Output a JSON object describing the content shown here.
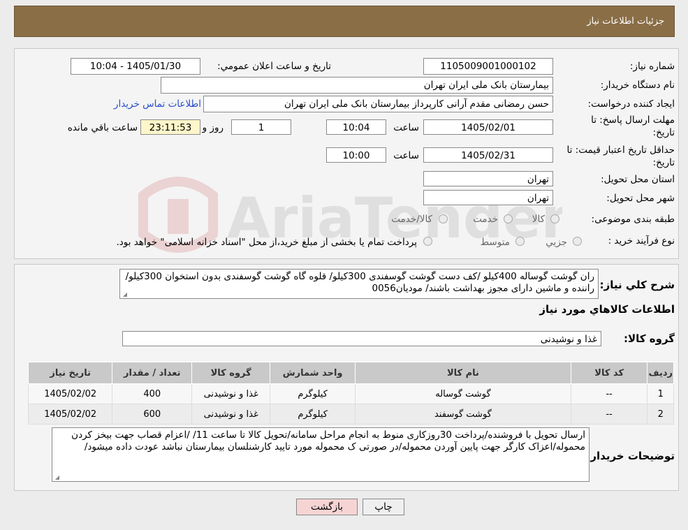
{
  "header": {
    "title": "جزئیات اطلاعات نیاز"
  },
  "need_number": {
    "label": "شماره نیاز:",
    "value": "1105009001000102"
  },
  "announce_datetime": {
    "label": "تاریخ و ساعت اعلان عمومي:",
    "value": "1405/01/30 - 10:04"
  },
  "buyer_org": {
    "label": "نام دستگاه خريدار:",
    "value": "بيمارستان بانک ملی ايران تهران"
  },
  "requester": {
    "label": "ايجاد کننده درخواست:",
    "value": "حسن رمضانی مقدم آرانی کارپرداز بيمارستان بانک ملی ايران تهران",
    "contact_link": "اطلاعات تماس خريدار"
  },
  "reply_deadline": {
    "label_line1": "مهلت ارسال پاسخ: تا",
    "label_line2": "تاريخ:",
    "date": "1405/02/01",
    "time_label": "ساعت",
    "time": "10:04",
    "days": "1",
    "days_label": "روز و",
    "remaining": "23:11:53",
    "remaining_label": "ساعت باقي مانده"
  },
  "price_validity": {
    "label_line1": "حداقل تاريخ اعتبار قيمت: تا",
    "label_line2": "تاريخ:",
    "date": "1405/02/31",
    "time_label": "ساعت",
    "time": "10:00"
  },
  "delivery_province": {
    "label": "استان محل تحويل:",
    "value": "تهران"
  },
  "delivery_city": {
    "label": "شهر محل تحويل:",
    "value": "تهران"
  },
  "category": {
    "label": "طبقه بندی موضوعی:",
    "options": [
      "کالا",
      "خدمت",
      "کالا/خدمت"
    ]
  },
  "purchase_type": {
    "label": "نوع فرآيند خريد :",
    "options": [
      "جزيي",
      "متوسط"
    ],
    "note": "پرداخت تمام يا بخشی از مبلغ خريد،از محل \"اسناد خزانه اسلامی\" خواهد بود."
  },
  "general_desc": {
    "label": "شرح کلي نياز:",
    "value": "ران گوشت گوساله 400کيلو /کف دست گوشت گوسفندی  300کيلو/ قلوه گاه گوشت گوسفندی بدون استخوان 300کيلو/راننده و ماشين دارای مجوز بهداشت باشند/  موديان0056"
  },
  "goods_info_title": "اطلاعات کالاهاي مورد نياز",
  "goods_group": {
    "label": "گروه کالا:",
    "value": "غذا و نوشيدنی"
  },
  "table": {
    "headers": [
      "رديف",
      "کد کالا",
      "نام کالا",
      "واحد شمارش",
      "گروه کالا",
      "تعداد / مقدار",
      "تاريخ نياز"
    ],
    "rows": [
      [
        "1",
        "--",
        "گوشت گوساله",
        "کيلوگرم",
        "غذا و نوشيدنی",
        "400",
        "1405/02/02"
      ],
      [
        "2",
        "--",
        "گوشت گوسفند",
        "کيلوگرم",
        "غذا و نوشيدنی",
        "600",
        "1405/02/02"
      ]
    ]
  },
  "buyer_notes": {
    "label": "توضيحات خريدار:",
    "value": "ارسال تحويل با فروشنده/پرداخت 30روزکاری منوط به انجام مراحل سامانه/تحويل کالا تا ساعت 11/ /اعزام قصاب جهت بيخز کردن محموله/اعزاک کارگر جهت پايين آوردن محموله/در صورتی ک محموله مورد تاييد کارشنلسان بيمارستان نباشد عودت داده ميشود/"
  },
  "buttons": {
    "print": "چاپ",
    "back": "بازگشت"
  },
  "watermark": {
    "text": "AriaTender.neT"
  },
  "colors": {
    "header_bg": "#8a6e46",
    "link": "#2a4ec9",
    "back_button_bg": "#f7d4d4",
    "remaining_bg": "#fdf6c9"
  }
}
